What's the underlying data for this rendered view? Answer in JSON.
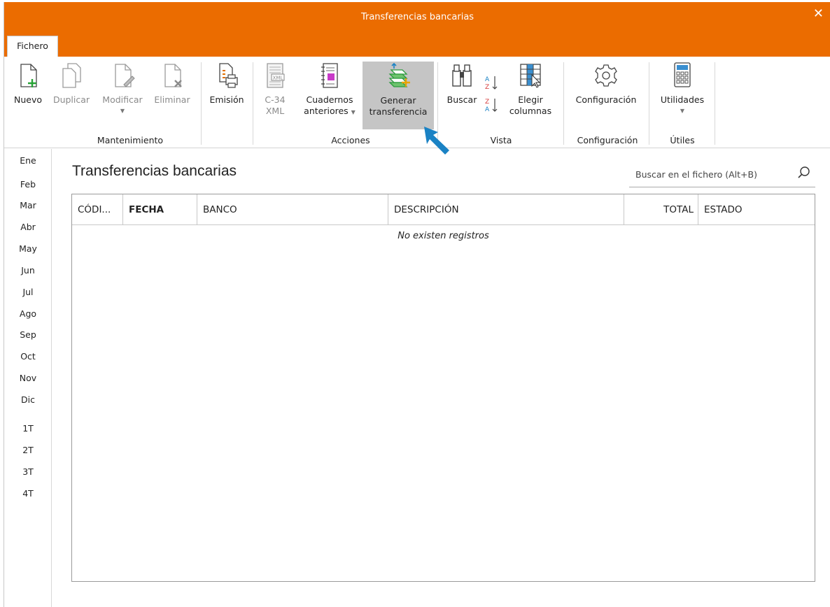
{
  "window": {
    "title": "Transferencias bancarias",
    "close": "✕"
  },
  "tabs": [
    {
      "label": "Fichero"
    }
  ],
  "ribbon": {
    "mantenimiento": {
      "label": "Mantenimiento",
      "nuevo": "Nuevo",
      "duplicar": "Duplicar",
      "modificar": "Modificar",
      "eliminar": "Eliminar",
      "emision": "Emisión"
    },
    "acciones": {
      "label": "Acciones",
      "c34_line1": "C-34",
      "c34_line2": "XML",
      "cuadernos_line1": "Cuadernos",
      "cuadernos_line2": "anteriores",
      "generar_line1": "Generar",
      "generar_line2": "transferencia"
    },
    "vista": {
      "label": "Vista",
      "buscar": "Buscar",
      "elegir_line1": "Elegir",
      "elegir_line2": "columnas"
    },
    "configuracion": {
      "label": "Configuración",
      "configuracion": "Configuración"
    },
    "utiles": {
      "label": "Útiles",
      "utilidades": "Utilidades"
    }
  },
  "sidebar": {
    "items": [
      "Ene",
      "Feb",
      "Mar",
      "Abr",
      "May",
      "Jun",
      "Jul",
      "Ago",
      "Sep",
      "Oct",
      "Nov",
      "Dic",
      "1T",
      "2T",
      "3T",
      "4T"
    ]
  },
  "main": {
    "title": "Transferencias bancarias",
    "search_placeholder": "Buscar en el fichero (Alt+B)",
    "columns": [
      "CÓDI...",
      "FECHA",
      "BANCO",
      "DESCRIPCIÓN",
      "TOTAL",
      "ESTADO"
    ],
    "empty_message": "No existen registros"
  },
  "colors": {
    "accent": "#eb6c00",
    "pointer": "#1a82c4",
    "active_button": "#c5c5c5"
  },
  "icons": [
    "new-document-icon",
    "duplicate-icon",
    "modify-icon",
    "delete-icon",
    "print-icon",
    "xml-icon",
    "notebook-icon",
    "money-transfer-icon",
    "binoculars-icon",
    "sort-icon",
    "columns-icon",
    "gear-icon",
    "calculator-icon",
    "search-icon",
    "pointer-arrow-icon"
  ]
}
